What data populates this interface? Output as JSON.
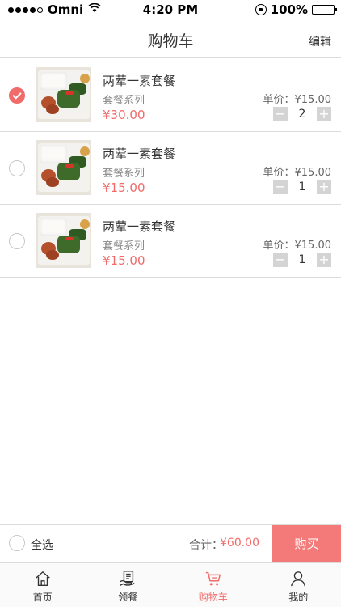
{
  "status_bar": {
    "carrier": "Omni",
    "time": "4:20 PM",
    "battery": "100%"
  },
  "navbar": {
    "title": "购物车",
    "edit_label": "编辑"
  },
  "cart": {
    "items": [
      {
        "name": "两荤一素套餐",
        "series": "套餐系列",
        "subtotal": "¥30.00",
        "unit_price": "单价：¥15.00",
        "quantity": "2",
        "checked": true
      },
      {
        "name": "两荤一素套餐",
        "series": "套餐系列",
        "subtotal": "¥15.00",
        "unit_price": "单价：¥15.00",
        "quantity": "1",
        "checked": false
      },
      {
        "name": "两荤一素套餐",
        "series": "套餐系列",
        "subtotal": "¥15.00",
        "unit_price": "单价：¥15.00",
        "quantity": "1",
        "checked": false
      }
    ]
  },
  "checkout": {
    "select_all_label": "全选",
    "total_label": "合计：",
    "total_value": "¥60.00",
    "buy_label": "购买"
  },
  "tabbar": {
    "tabs": [
      {
        "label": "首页",
        "icon": "home-icon",
        "active": false
      },
      {
        "label": "领餐",
        "icon": "meal-pickup-icon",
        "active": false
      },
      {
        "label": "购物车",
        "icon": "cart-icon",
        "active": true
      },
      {
        "label": "我的",
        "icon": "profile-icon",
        "active": false
      }
    ]
  },
  "colors": {
    "accent": "#f26b6b",
    "buy_button": "#f47a7a",
    "stepper": "#d4d4d4"
  }
}
